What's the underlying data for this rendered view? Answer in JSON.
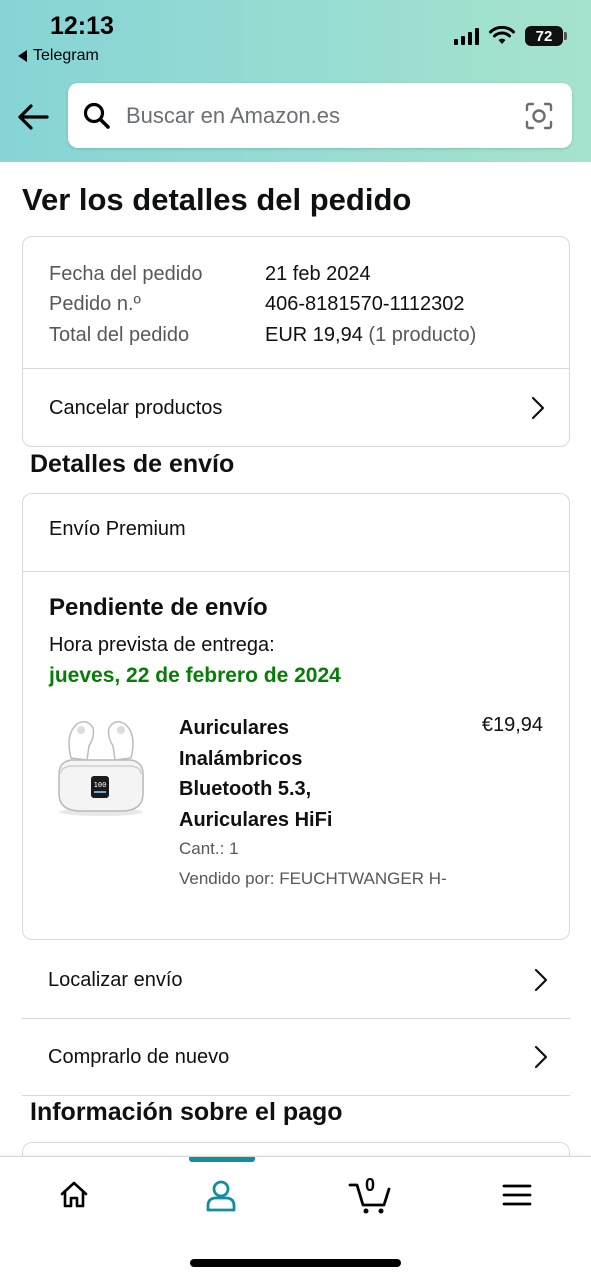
{
  "status_bar": {
    "time": "12:13",
    "back_app": "Telegram",
    "battery": "72"
  },
  "search": {
    "placeholder": "Buscar en Amazon.es"
  },
  "page": {
    "title": "Ver los detalles del pedido"
  },
  "order_summary": {
    "rows": [
      {
        "label": "Fecha del pedido",
        "value": "21 feb 2024",
        "extra": ""
      },
      {
        "label": "Pedido n.º",
        "value": "406-8181570-1112302",
        "extra": ""
      },
      {
        "label": "Total del pedido",
        "value": "EUR 19,94",
        "extra": "(1 producto)"
      }
    ],
    "cancel_label": "Cancelar productos"
  },
  "shipping": {
    "section_title": "Detalles de envío",
    "type": "Envío Premium",
    "status": "Pendiente de envío",
    "eta_label": "Hora prevista de entrega:",
    "eta_date": "jueves, 22 de febrero de 2024",
    "eta_color": "#067d06",
    "product": {
      "name_lines": [
        "Auriculares",
        "Inalámbricos",
        "Bluetooth 5.3,",
        "Auriculares HiFi"
      ],
      "price": "€19,94",
      "qty": "Cant.: 1",
      "seller": "Vendido por: FEUCHTWANGER H-"
    },
    "track_label": "Localizar envío",
    "buy_again_label": "Comprarlo de nuevo"
  },
  "payment": {
    "section_title": "Información sobre el pago"
  },
  "bottom_nav": {
    "cart_count": "0",
    "active": "account",
    "accent_color": "#138da0",
    "items": [
      "home-icon",
      "account-icon",
      "cart-icon",
      "menu-icon"
    ]
  }
}
